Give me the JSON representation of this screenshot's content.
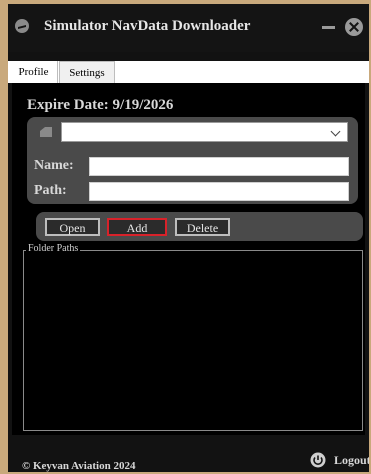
{
  "window": {
    "title": "Simulator NavData Downloader"
  },
  "tabs": [
    {
      "label": "Profile"
    },
    {
      "label": "Settings"
    }
  ],
  "settings": {
    "expire_date": "Expire Date: 9/19/2026",
    "source_select_value": "",
    "name_label": "Name:",
    "name_value": "",
    "path_label": "Path:",
    "path_value": "",
    "buttons": {
      "open": "Open",
      "add": "Add",
      "delete": "Delete"
    },
    "folder_paths_legend": "Folder Paths"
  },
  "footer": {
    "copyright": "© Keyvan Aviation 2024",
    "logout": "Logout"
  },
  "colors": {
    "background": "#121212",
    "accent_add_border": "#d8222a",
    "desk": "#c9a97c"
  }
}
